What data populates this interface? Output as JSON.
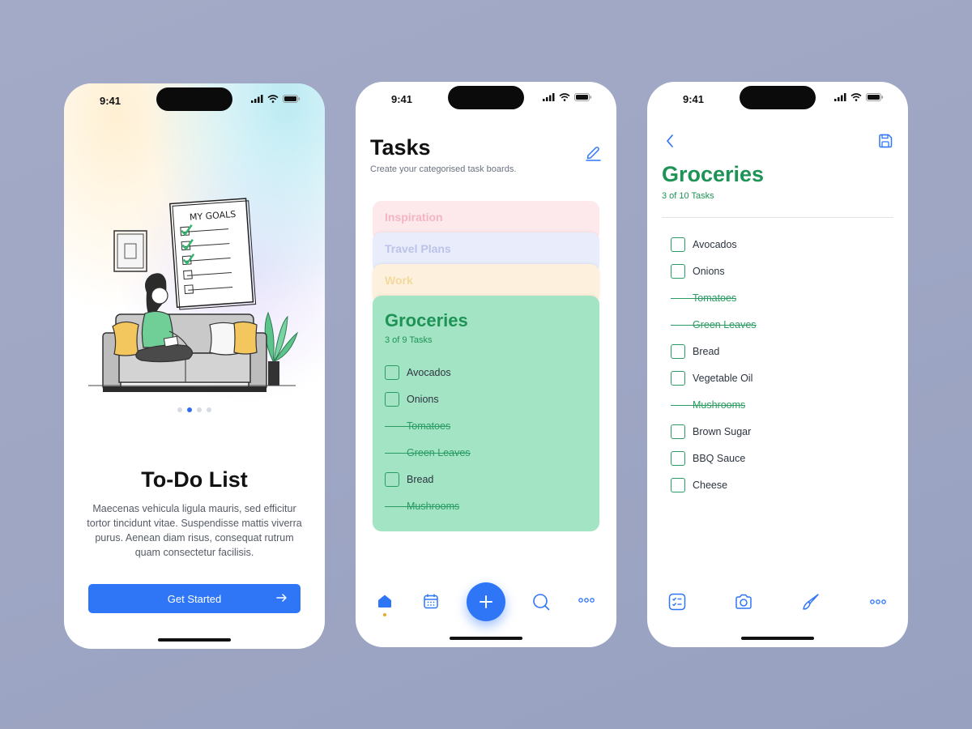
{
  "status_bar": {
    "time": "9:41"
  },
  "onboarding": {
    "illustration_note_title": "MY GOALS",
    "title": "To-Do List",
    "description": "Maecenas vehicula ligula mauris, sed efficitur tortor tincidunt vitae. Suspendisse mattis viverra purus. Aenean diam risus, consequat rutrum quam consectetur facilisis.",
    "button_label": "Get Started",
    "pager": {
      "count": 4,
      "active_index": 1
    }
  },
  "tasks_screen": {
    "title": "Tasks",
    "subtitle": "Create your categorised task boards.",
    "boards": [
      {
        "name": "Inspiration",
        "color": "#fde8ec"
      },
      {
        "name": "Travel Plans",
        "color": "#e9ecfb"
      },
      {
        "name": "Work",
        "color": "#fdf1dd"
      }
    ],
    "active_board": {
      "name": "Groceries",
      "count": "3 of 9 Tasks",
      "color": "#a3e4c4",
      "tasks": [
        {
          "label": "Avocados",
          "done": false
        },
        {
          "label": "Onions",
          "done": false
        },
        {
          "label": "Tomatoes",
          "done": true
        },
        {
          "label": "Green Leaves",
          "done": true
        },
        {
          "label": "Bread",
          "done": false
        },
        {
          "label": "Mushrooms",
          "done": true
        }
      ]
    },
    "tabbar": [
      "home-icon",
      "calendar-icon",
      "add-icon",
      "search-icon",
      "more-icon"
    ]
  },
  "detail_screen": {
    "title": "Groceries",
    "count": "3 of 10 Tasks",
    "tasks": [
      {
        "label": "Avocados",
        "done": false
      },
      {
        "label": "Onions",
        "done": false
      },
      {
        "label": "Tomatoes",
        "done": true
      },
      {
        "label": "Green Leaves",
        "done": true
      },
      {
        "label": "Bread",
        "done": false
      },
      {
        "label": "Vegetable Oil",
        "done": false
      },
      {
        "label": "Mushrooms",
        "done": true
      },
      {
        "label": "Brown Sugar",
        "done": false
      },
      {
        "label": "BBQ Sauce",
        "done": false
      },
      {
        "label": "Cheese",
        "done": false
      }
    ],
    "tabbar": [
      "checklist-icon",
      "camera-icon",
      "brush-icon",
      "more-icon"
    ]
  },
  "colors": {
    "accent": "#2f76f7",
    "green": "#1e9356",
    "background": "#9ea6c4"
  }
}
